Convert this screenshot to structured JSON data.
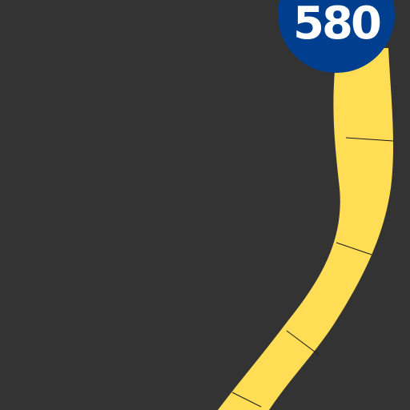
{
  "map": {
    "background_color": "#333333",
    "road": {
      "kind": "highway",
      "color": "#FFDD55",
      "segment_line_color": "#1a1a1a"
    },
    "route_shield": {
      "label": "580",
      "fill_color": "#003F8F",
      "text_color": "#FFFFFF",
      "shape": "circle"
    }
  }
}
